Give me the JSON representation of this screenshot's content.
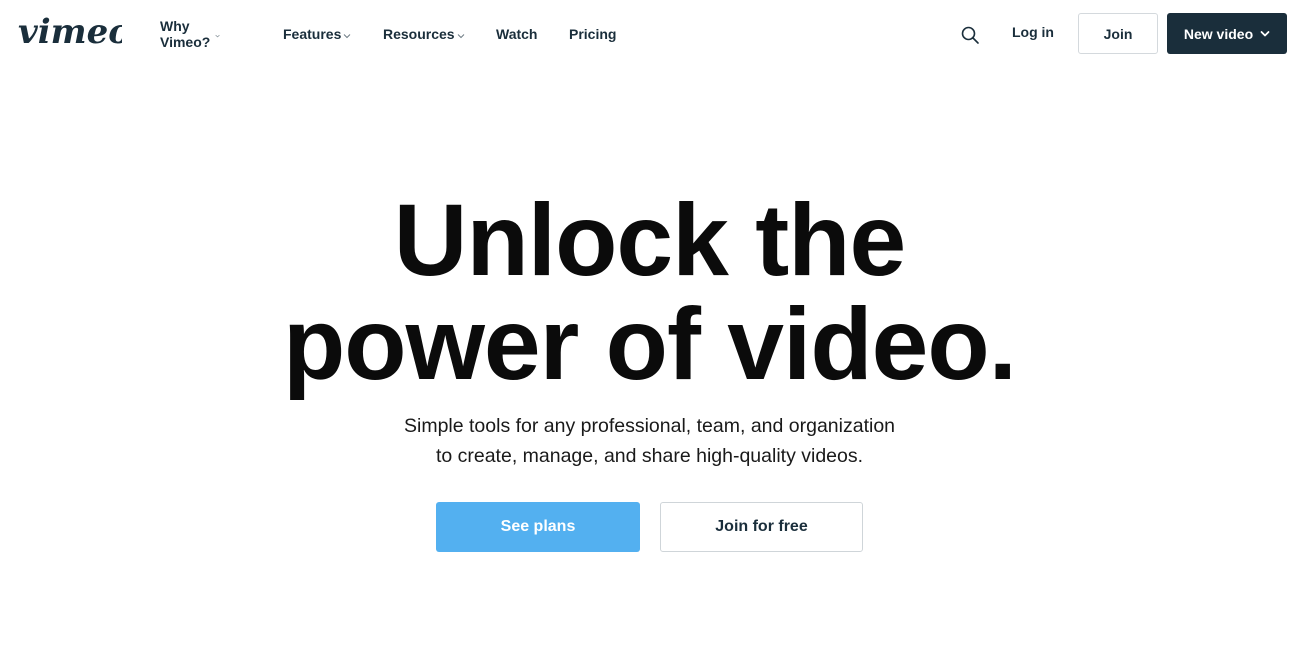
{
  "brand": {
    "logo_text": "vimeo",
    "color": "#1a2e3b"
  },
  "nav": {
    "items": [
      {
        "label": "Why Vimeo?",
        "has_dropdown": true
      },
      {
        "label": "Features",
        "has_dropdown": true
      },
      {
        "label": "Resources",
        "has_dropdown": true
      },
      {
        "label": "Watch",
        "has_dropdown": false
      },
      {
        "label": "Pricing",
        "has_dropdown": false
      }
    ],
    "search_icon": "search-icon",
    "login_label": "Log in",
    "join_label": "Join",
    "new_video_label": "New video"
  },
  "hero": {
    "title_line1": "Unlock the",
    "title_line2": "power of video.",
    "subtitle_line1": "Simple tools for any professional, team, and organization",
    "subtitle_line2": "to create, manage, and share high-quality videos.",
    "primary_cta": "See plans",
    "secondary_cta": "Join for free"
  },
  "colors": {
    "primary_button": "#53b0f0",
    "dark_button": "#1a2e3b",
    "text": "#1a2e3b"
  }
}
